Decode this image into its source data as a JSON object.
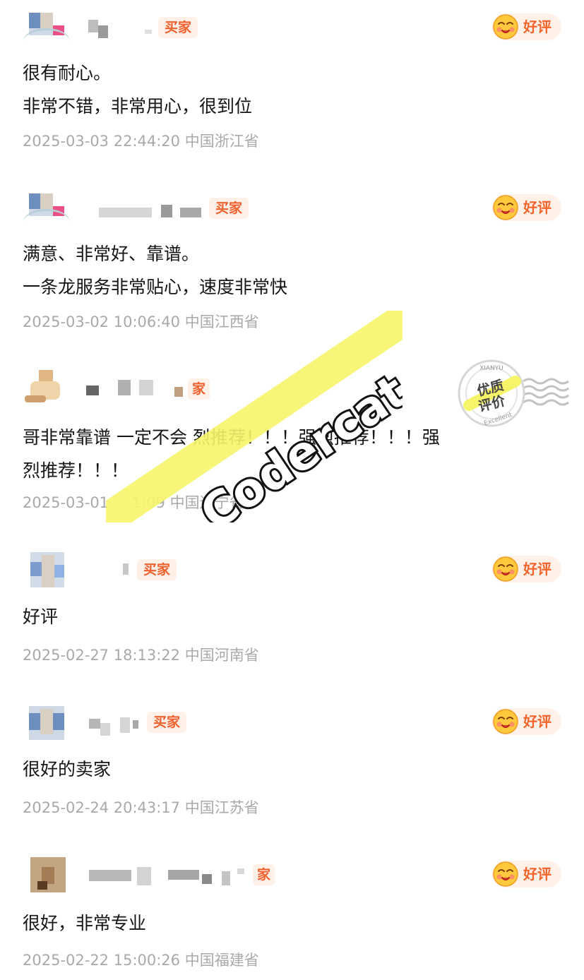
{
  "colors": {
    "buyer_tag_bg": "#fff0e8",
    "buyer_tag_text": "#f0602d",
    "rating_text": "#f26329",
    "meta_text": "#a9a9a9"
  },
  "reviews": [
    {
      "buyer_tag": "买家",
      "rating_label": "好评",
      "rating_icon": "smiling-face-icon",
      "comment": "很有耐心。\n非常不错，非常用心，很到位",
      "date": "2025-03-03 22:44:20",
      "location": "中国浙江省"
    },
    {
      "buyer_tag": "买家",
      "rating_label": "好评",
      "rating_icon": "smiling-face-icon",
      "comment": "满意、非常好、靠谱。\n一条龙服务非常贴心，速度非常快",
      "date": "2025-03-02 10:06:40",
      "location": "中国江西省"
    },
    {
      "buyer_tag": "家",
      "rating_label": "",
      "rating_icon": "",
      "comment": "哥非常靠谱 一定不会 烈推荐！！！强烈推荐！！！强\n烈推荐！！！",
      "date": "2025-03-01",
      "date_tail": "1:09",
      "location": "中国辽宁省"
    },
    {
      "buyer_tag": "买家",
      "rating_label": "好评",
      "rating_icon": "smiling-face-icon",
      "comment": "好评",
      "date": "2025-02-27 18:13:22",
      "location": "中国河南省"
    },
    {
      "buyer_tag": "买家",
      "rating_label": "好评",
      "rating_icon": "smiling-face-icon",
      "comment": "很好的卖家",
      "date": "2025-02-24 20:43:17",
      "location": "中国江苏省"
    },
    {
      "buyer_tag": "家",
      "rating_label": "好评",
      "rating_icon": "smiling-face-icon",
      "comment": "很好，非常专业",
      "date": "2025-02-22 15:00:26",
      "location": "中国福建省"
    }
  ],
  "watermark": {
    "text": "Codercat",
    "highlight_color": "#f6f56a"
  },
  "stamp": {
    "top_text": "XIANYU",
    "line1": "优质",
    "line2": "评价",
    "bottom_text": "Excellent",
    "icon": "quality-review-stamp-icon"
  }
}
